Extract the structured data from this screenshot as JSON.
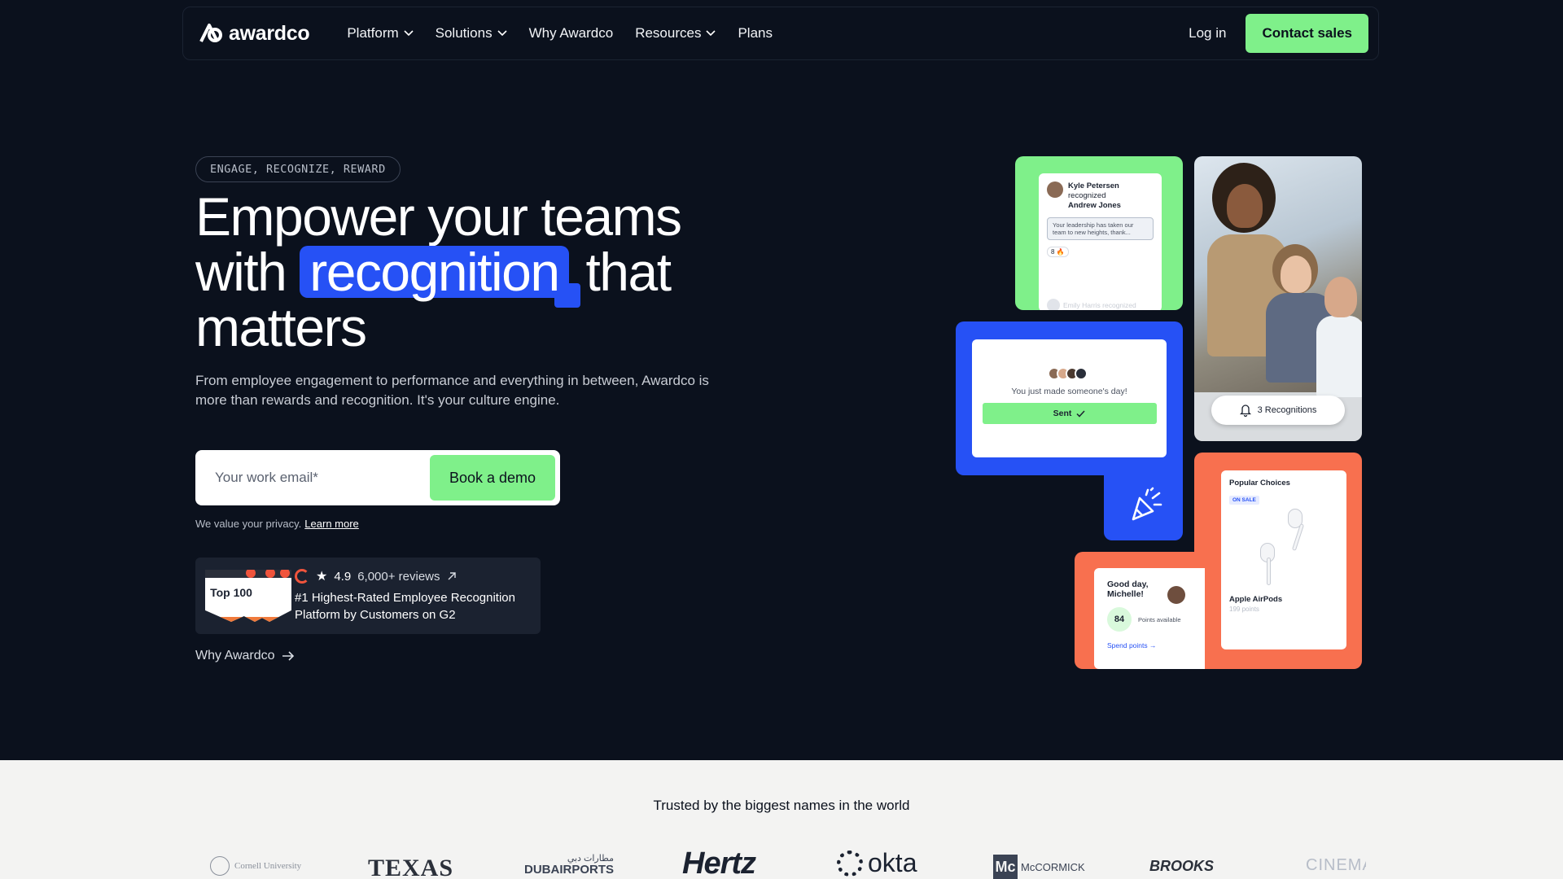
{
  "nav": {
    "logo_text": "awardco",
    "items": [
      {
        "label": "Platform",
        "has_dropdown": true
      },
      {
        "label": "Solutions",
        "has_dropdown": true
      },
      {
        "label": "Why Awardco",
        "has_dropdown": false
      },
      {
        "label": "Resources",
        "has_dropdown": true
      },
      {
        "label": "Plans",
        "has_dropdown": false
      }
    ],
    "login": "Log in",
    "contact": "Contact sales"
  },
  "hero": {
    "tagline": "ENGAGE, RECOGNIZE, REWARD",
    "headline_part1": "Empower your teams with",
    "headline_highlight": "recognition",
    "headline_part2": "that matters",
    "subtext": "From employee engagement to performance and everything in between, Awardco is more than rewards and recognition. It's your culture engine.",
    "email_placeholder": "Your work email*",
    "demo_button": "Book a demo",
    "privacy_text": "We value your privacy.",
    "privacy_link": "Learn more",
    "g2": {
      "badge_text": "Top 100",
      "rating": "4.9",
      "reviews": "6,000+ reviews",
      "description": "#1 Highest-Rated Employee Recognition Platform by Customers on G2"
    },
    "why_link": "Why Awardco"
  },
  "collage": {
    "feed": {
      "headline_name": "Kyle Petersen",
      "headline_action": "recognized",
      "headline_target": "Andrew Jones",
      "quote": "Your leadership has taken our team to new heights, thank...",
      "reaction": "8 🔥",
      "faded": "Emily Harris recognized"
    },
    "photo_pill": "3 Recognitions",
    "sent": {
      "message": "You just made someone's day!",
      "button": "Sent"
    },
    "shop": {
      "title": "Popular Choices",
      "badge": "ON SALE",
      "product": "Apple AirPods",
      "points": "199 points"
    },
    "points": {
      "greeting": "Good day, Michelle!",
      "value": "84",
      "label": "Points available",
      "spend": "Spend points →"
    }
  },
  "trusted": {
    "title": "Trusted by the biggest names in the world",
    "brands": {
      "cornell": "Cornell University",
      "texas": "TEXAS",
      "dubai_ar": "مطارات دبي",
      "dubai": "DUBAIRPORTS",
      "hertz": "Hertz",
      "okta": "okta",
      "mcc_mark": "Mc",
      "mcc": "McCORMICK",
      "brooks": "BROOKS",
      "cinema": "CINEMA"
    }
  },
  "colors": {
    "background": "#0b111d",
    "accent_green": "#7ff08a",
    "accent_blue": "#2651f5",
    "accent_orange": "#f8704f"
  }
}
